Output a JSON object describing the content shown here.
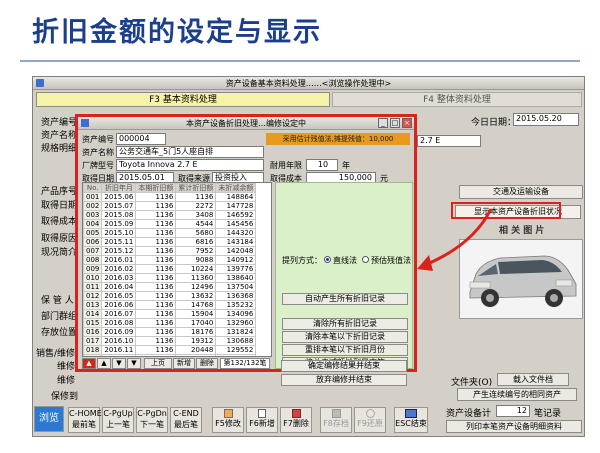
{
  "slide_title": "折旧金额的设定与显示",
  "window": {
    "title": "资产设备基本资料处理……<浏览操作处理中>",
    "tab_basic": "F3 基本资料处理",
    "tab_whole": "F4 整体资料处理",
    "today_label": "今日日期：",
    "today": "2015.05.20"
  },
  "bg_labels": [
    "资产编号",
    "资产名称",
    "规格明细",
    "产品序号",
    "取得日期",
    "取得成本",
    "取得原因",
    "现况简介",
    "保 管 人",
    "部门群组",
    "存放位置",
    "销售/维修",
    "维修",
    "维修",
    "保修到"
  ],
  "bg_right": {
    "spec_value": "2.7 E",
    "btn_transport": "交通及运输设备",
    "btn_show_dep": "显示本资产设备折旧状况",
    "photo_label": "相 关 图 片",
    "file_box_label": "文件夹(O)",
    "btn_load_file": "载入文件档",
    "btn_generate": "产生连续编号的相同资产",
    "asset_total_label": "资产设备计",
    "asset_total_value": "12",
    "asset_total_unit": "笔记录",
    "btn_print_list": "列印本笔资产设备明细资料"
  },
  "modal": {
    "title": "本资产设备折旧处理…编修设定中",
    "asset_no_label": "资产编号",
    "asset_no": "000004",
    "asset_name_label": "资产名称",
    "asset_name": "公务交通车_5门5人座自排",
    "model_label": "厂牌型号",
    "model": "Toyota Innova 2.7 E",
    "acq_date_label": "取得日期",
    "acq_date": "2015.05.01",
    "source_label": "取得来源",
    "source": "投资投入",
    "life_label": "耐用年限",
    "life_value": "10",
    "life_unit": "年",
    "cost_label": "取得成本",
    "cost_value": "150,000",
    "cost_unit": "元",
    "salvage_banner": "采用估计残值法,摊提残值：10,000",
    "method_label": "提列方式：",
    "method_straight": "直线法",
    "method_salvage": "预估残值法",
    "columns": [
      "No.",
      "折旧年月",
      "本期折旧额",
      "累计折旧额",
      "未折减余额"
    ],
    "rows": [
      [
        "001",
        "2015.06",
        "1136",
        "1136",
        "148864"
      ],
      [
        "002",
        "2015.07",
        "1136",
        "2272",
        "147728"
      ],
      [
        "003",
        "2015.08",
        "1136",
        "3408",
        "146592"
      ],
      [
        "004",
        "2015.09",
        "1136",
        "4544",
        "145456"
      ],
      [
        "005",
        "2015.10",
        "1136",
        "5680",
        "144320"
      ],
      [
        "006",
        "2015.11",
        "1136",
        "6816",
        "143184"
      ],
      [
        "007",
        "2015.12",
        "1136",
        "7952",
        "142048"
      ],
      [
        "008",
        "2016.01",
        "1136",
        "9088",
        "140912"
      ],
      [
        "009",
        "2016.02",
        "1136",
        "10224",
        "139776"
      ],
      [
        "010",
        "2016.03",
        "1136",
        "11360",
        "138640"
      ],
      [
        "011",
        "2016.04",
        "1136",
        "12496",
        "137504"
      ],
      [
        "012",
        "2016.05",
        "1136",
        "13632",
        "136368"
      ],
      [
        "013",
        "2016.06",
        "1136",
        "14768",
        "135232"
      ],
      [
        "014",
        "2016.07",
        "1136",
        "15904",
        "134096"
      ],
      [
        "015",
        "2016.08",
        "1136",
        "17040",
        "132960"
      ],
      [
        "016",
        "2016.09",
        "1136",
        "18176",
        "131824"
      ],
      [
        "017",
        "2016.10",
        "1136",
        "19312",
        "130688"
      ],
      [
        "018",
        "2016.11",
        "1136",
        "20448",
        "129552"
      ],
      [
        "019",
        "2016.12",
        "1136",
        "21584",
        "128416"
      ]
    ],
    "buttons": {
      "auto_generate": "自动产生所有折旧记录",
      "clear_all": "清除所有折旧记录",
      "clear_below": "清除本笔以下折旧记录",
      "rearrange": "重排本笔以下折旧月份",
      "adjust_last": "将总未减额摊到最末笔",
      "confirm": "确定编修结果并结束",
      "discard": "放弃编修并结束"
    },
    "nav": {
      "prev_page": "上页",
      "add": "新增",
      "delete": "删除",
      "counter": "第132/132笔"
    }
  },
  "toolbar": {
    "browse": "浏览",
    "first": "C-HOME\n最前笔",
    "prev": "C-PgUp\n上一笔",
    "next": "C-PgDn\n下一笔",
    "last": "C-END\n最后笔",
    "modify": "F5修改",
    "add": "F6新增",
    "delete": "F7删除",
    "save": "F8存档",
    "restore": "F9还原",
    "esc": "ESC结束"
  },
  "colors": {
    "title": "#1c3f8c",
    "highlight": "#d9231c",
    "tab_active": "#f6f2a8",
    "banner": "#e89a1e",
    "pane": "#d9f0c8",
    "selection": "#2a5ad8"
  }
}
